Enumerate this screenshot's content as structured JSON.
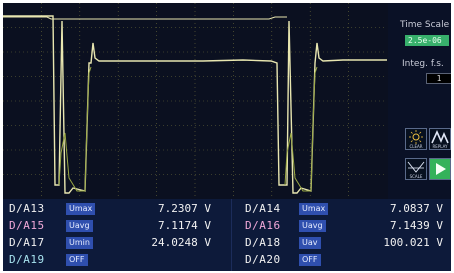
{
  "colors": {
    "screen_bg": "#0b1020",
    "grid": "#6b6a3a",
    "trace_main": "#e8e6b0",
    "trace_secondary": "#9aa844",
    "readout_bg": "#0d1a3a",
    "badge_bg": "#2f4fae",
    "channel_white": "#f2f2f2",
    "channel_pink": "#f0a8d8",
    "channel_yellow": "#f0e88a",
    "channel_cyan": "#a8e4f0",
    "active_value_bg": "#38b06c"
  },
  "side_panel": {
    "time_scale_label": "Time Scale",
    "time_scale_value": "2.5e-06",
    "integ_label": "Integ. f.s.",
    "integ_value": "1",
    "buttons": [
      {
        "icon": "sun-icon",
        "label": "CLEAR"
      },
      {
        "icon": "wave-icon",
        "label": "REPLAY"
      },
      {
        "icon": "zoom-icon",
        "label": "SCALE"
      },
      {
        "icon": "play-icon",
        "label": ""
      }
    ]
  },
  "readouts": [
    {
      "left": {
        "channel": "D/A13",
        "color_key": "channel_white",
        "badge": "Umax",
        "value": "7.2307 V"
      },
      "right": {
        "channel": "D/A14",
        "color_key": "channel_white",
        "badge": "Umax",
        "value": "7.0837 V"
      }
    },
    {
      "left": {
        "channel": "D/A15",
        "color_key": "channel_pink",
        "badge": "Uavg",
        "value": "7.1174 V"
      },
      "right": {
        "channel": "D/A16",
        "color_key": "channel_pink",
        "badge": "Uavg",
        "value": "7.1439 V"
      }
    },
    {
      "left": {
        "channel": "D/A17",
        "color_key": "channel_white",
        "badge": "Umin",
        "value": "24.0248 V"
      },
      "right": {
        "channel": "D/A18",
        "color_key": "channel_white",
        "badge": "Uav",
        "value": "100.021 V"
      }
    },
    {
      "left": {
        "channel": "D/A19",
        "color_key": "channel_cyan",
        "badge": "OFF",
        "value": ""
      },
      "right": {
        "channel": "D/A20",
        "color_key": "channel_white",
        "badge": "OFF",
        "value": ""
      }
    }
  ]
}
